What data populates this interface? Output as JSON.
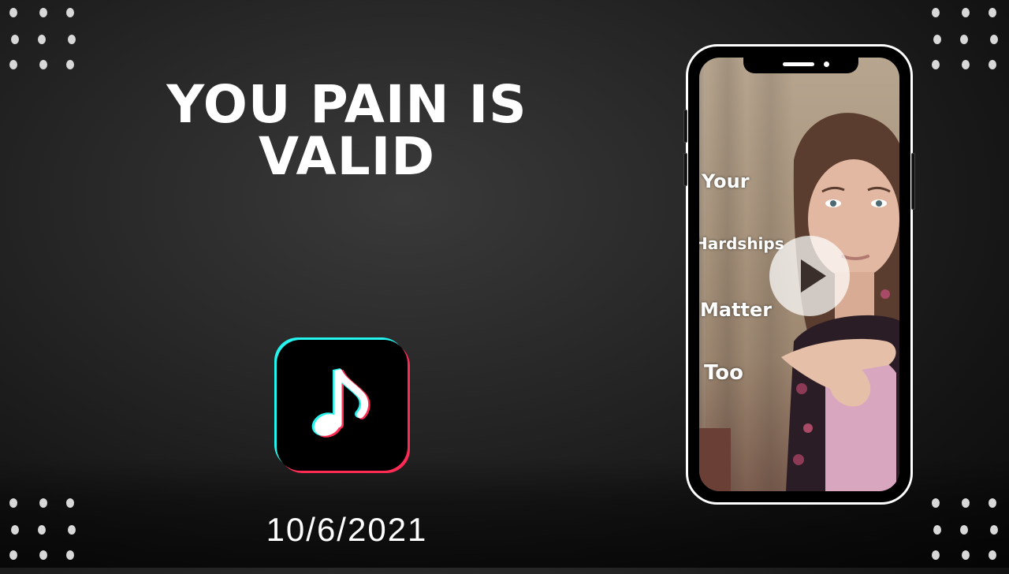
{
  "title_lines": [
    "YOU PAIN IS",
    "VALID"
  ],
  "date": "10/6/2021",
  "app_icon": "music-note-icon",
  "video": {
    "captions": [
      "Your",
      "Hardships",
      "Matter",
      "Too"
    ],
    "play_icon": "play-icon"
  },
  "colors": {
    "background": "#1e1e1e",
    "text": "#ffffff",
    "icon_cyan": "#25f4ee",
    "icon_red": "#fe2c55",
    "phone_frame": "#ffffff"
  }
}
